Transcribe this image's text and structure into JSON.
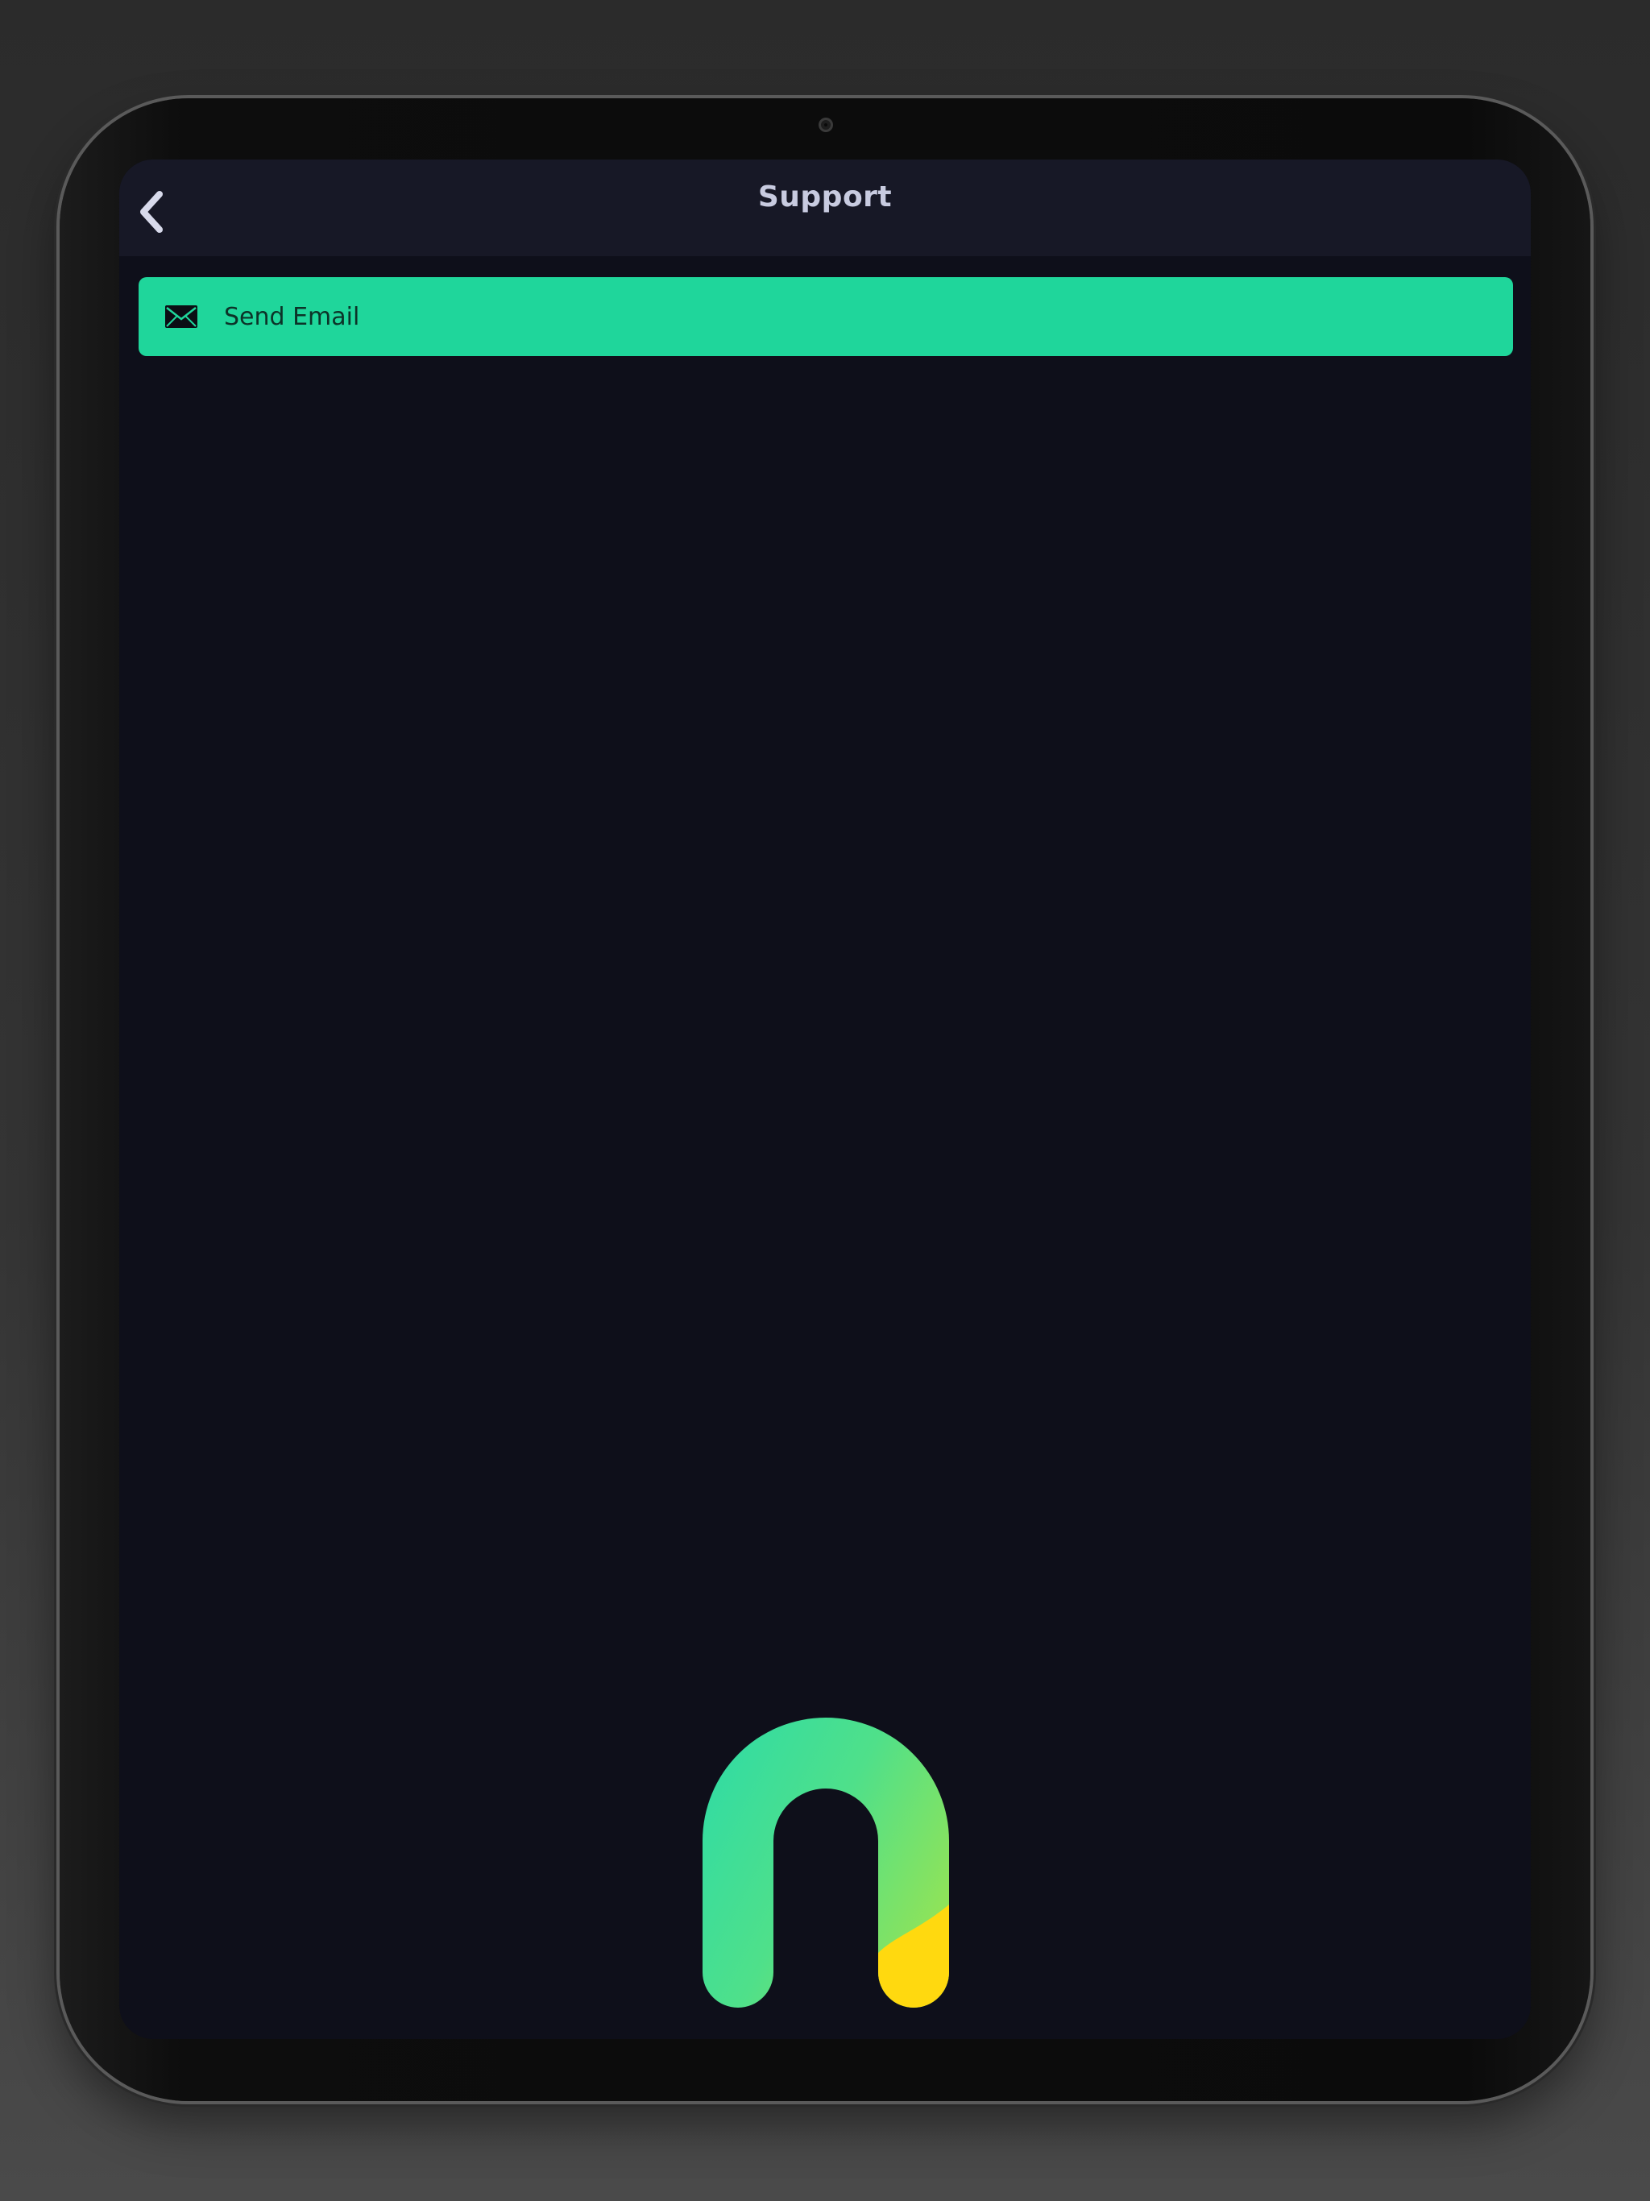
{
  "header": {
    "title": "Support",
    "back_icon": "chevron-left-icon"
  },
  "actions": {
    "send_email": {
      "label": "Send Email",
      "icon": "mail-icon"
    }
  },
  "branding": {
    "logo_icon": "app-logo-icon"
  },
  "colors": {
    "background": "#0e0f1a",
    "header": "#171826",
    "accent": "#1fd69b",
    "title_text": "#c8cbe0",
    "logo_gradient_start": "#2ddba7",
    "logo_gradient_end": "#86e35a",
    "logo_accent": "#ffd90f"
  }
}
